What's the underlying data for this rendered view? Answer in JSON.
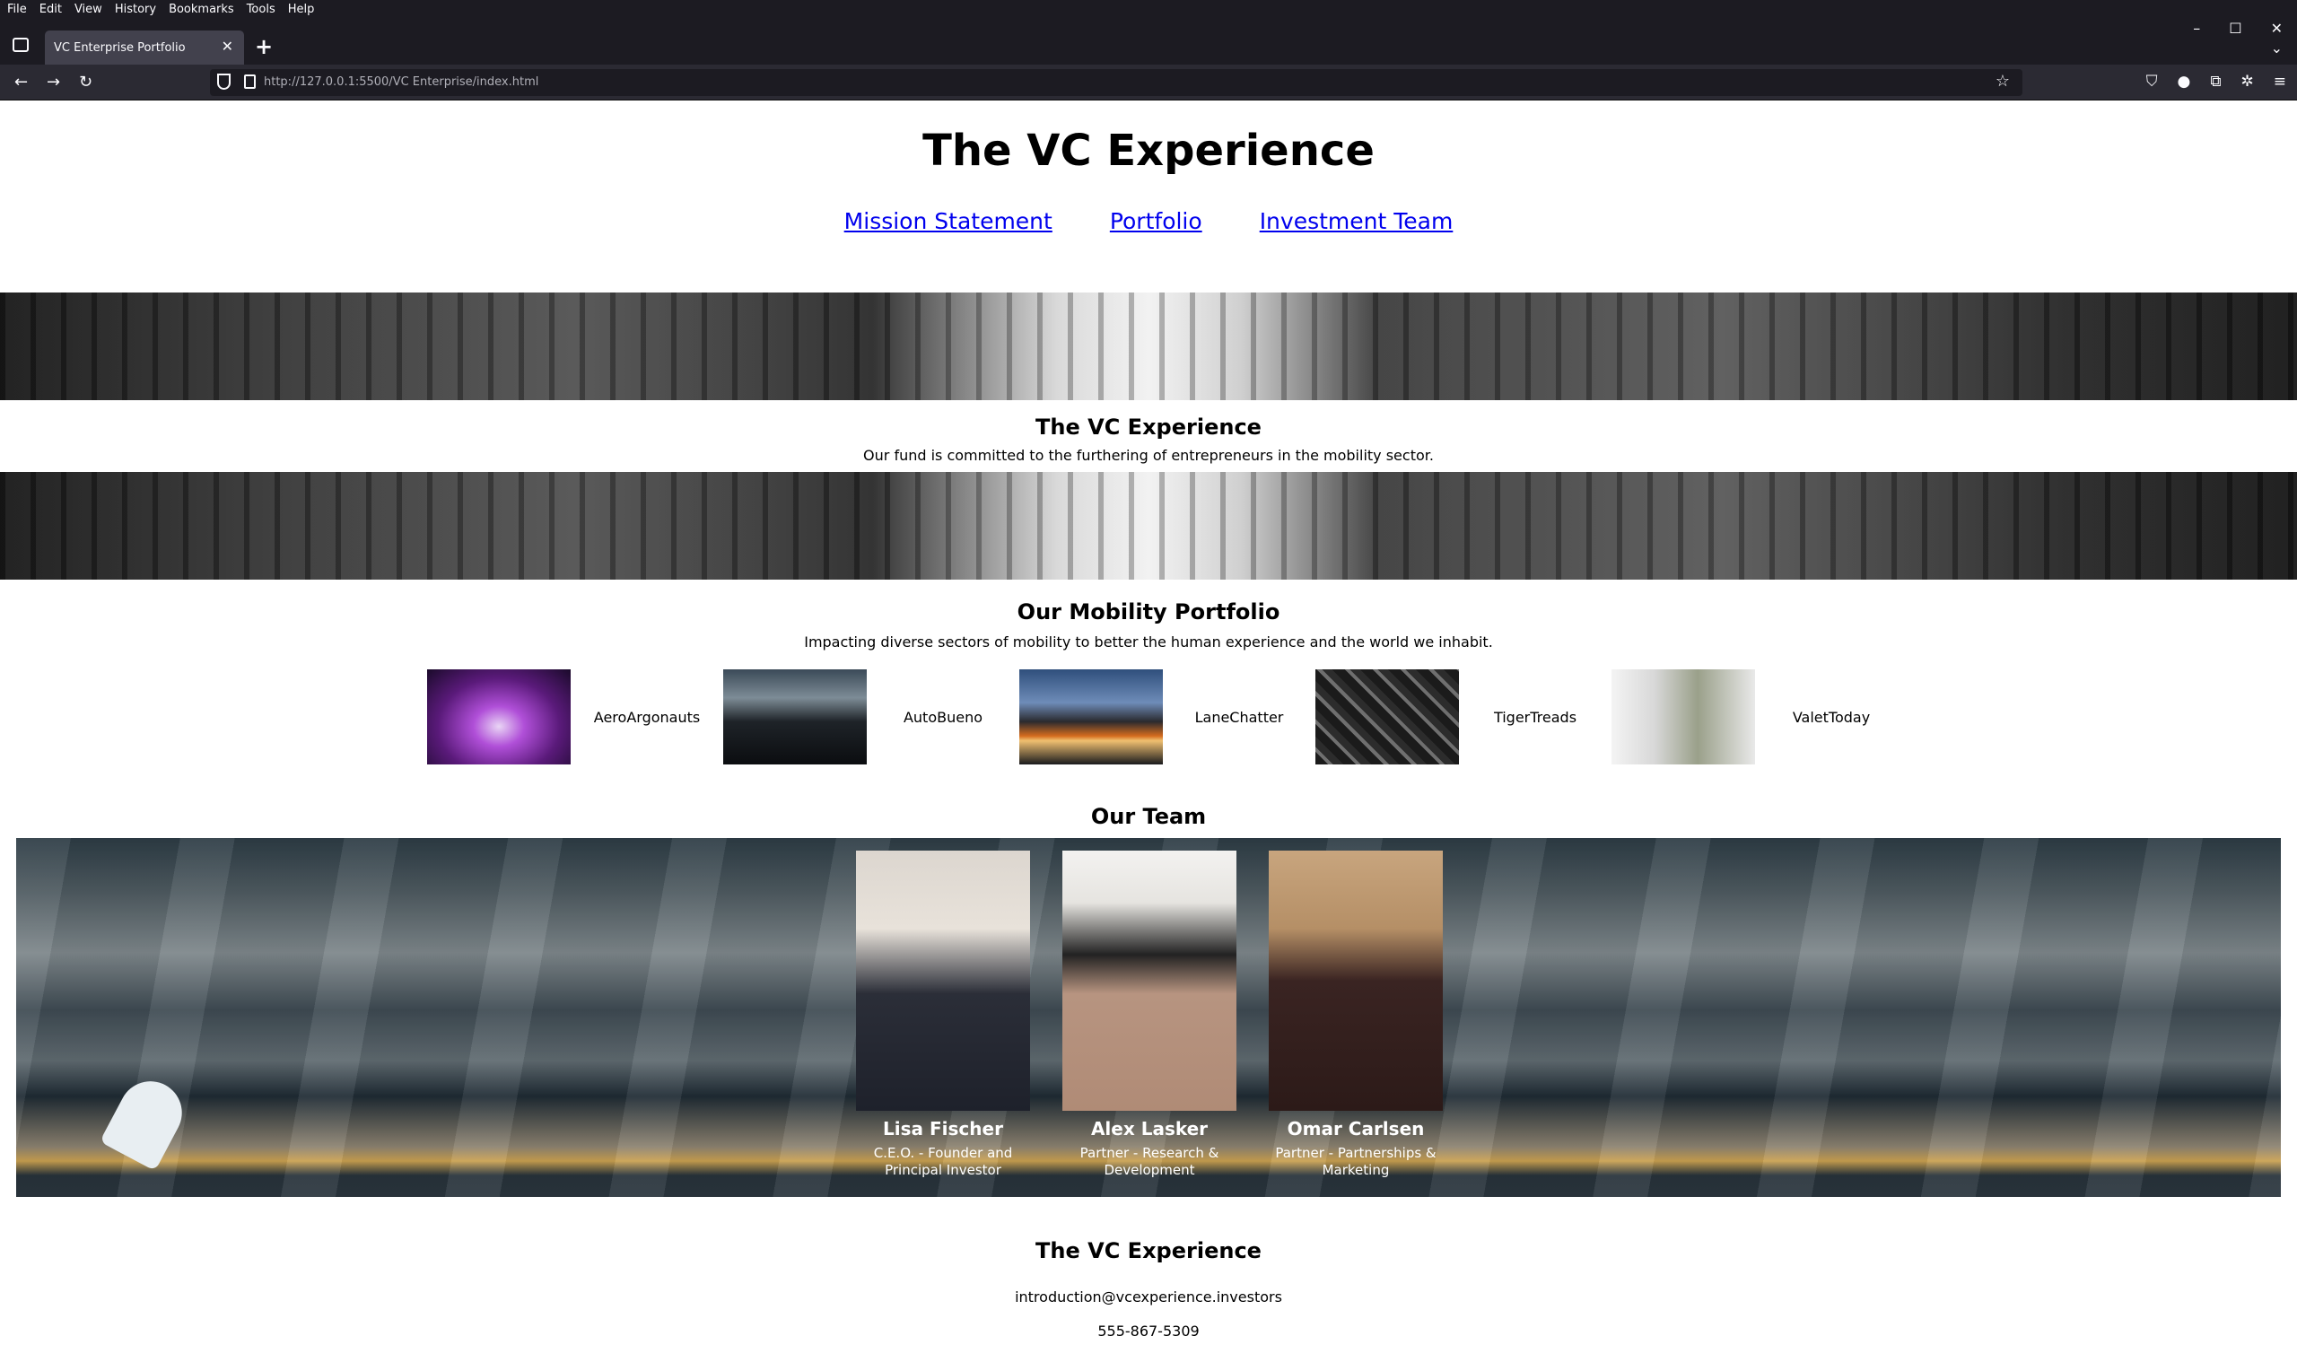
{
  "browser": {
    "menu": [
      "File",
      "Edit",
      "View",
      "History",
      "Bookmarks",
      "Tools",
      "Help"
    ],
    "tab_title": "VC Enterprise Portfolio",
    "url": "http://127.0.0.1:5500/VC Enterprise/index.html",
    "icons": {
      "tab_list": "tab-list-icon",
      "close": "close-icon",
      "new_tab": "plus-icon",
      "back": "arrow-left-icon",
      "forward": "arrow-right-icon",
      "reload": "reload-icon",
      "shield": "shield-icon",
      "page": "page-icon",
      "star": "star-icon",
      "pocket": "pocket-icon",
      "account": "account-icon",
      "extensions": "puzzle-icon",
      "settings": "gear-icon",
      "menu": "hamburger-icon"
    }
  },
  "header": {
    "title": "The VC Experience",
    "nav": [
      "Mission Statement",
      "Portfolio",
      "Investment Team"
    ]
  },
  "mission": {
    "title": "The VC Experience",
    "text": "Our fund is committed to the furthering of entrepreneurs in the mobility sector."
  },
  "portfolio": {
    "title": "Our Mobility Portfolio",
    "subtitle": "Impacting diverse sectors of mobility to better the human experience and the world we inhabit.",
    "items": [
      {
        "name": "AeroArgonauts"
      },
      {
        "name": "AutoBueno"
      },
      {
        "name": "LaneChatter"
      },
      {
        "name": "TigerTreads"
      },
      {
        "name": "ValetToday"
      }
    ]
  },
  "team": {
    "title": "Our Team",
    "members": [
      {
        "name": "Lisa Fischer",
        "role": "C.E.O. - Founder and Principal Investor"
      },
      {
        "name": "Alex Lasker",
        "role": "Partner - Research & Development"
      },
      {
        "name": "Omar Carlsen",
        "role": "Partner - Partnerships & Marketing"
      }
    ]
  },
  "footer": {
    "title": "The VC Experience",
    "email": "introduction@vcexperience.investors",
    "phone": "555-867-5309"
  }
}
